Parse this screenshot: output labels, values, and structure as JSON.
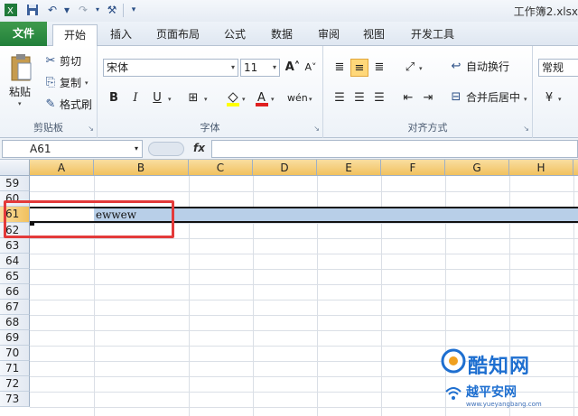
{
  "window": {
    "title": "工作簿2.xlsx"
  },
  "qat": {
    "icons": [
      "excel-app-icon",
      "save-icon",
      "undo-icon",
      "redo-icon",
      "format-painter-icon",
      "customize-qat-icon"
    ]
  },
  "tabs": [
    {
      "label": "文件"
    },
    {
      "label": "开始"
    },
    {
      "label": "插入"
    },
    {
      "label": "页面布局"
    },
    {
      "label": "公式"
    },
    {
      "label": "数据"
    },
    {
      "label": "审阅"
    },
    {
      "label": "视图"
    },
    {
      "label": "开发工具"
    }
  ],
  "ribbon": {
    "clipboard": {
      "label": "剪贴板",
      "paste": "粘贴",
      "cut": "剪切",
      "copy": "复制",
      "format_painter": "格式刷"
    },
    "font": {
      "label": "字体",
      "font_name": "宋体",
      "font_size": "11",
      "bold": "B",
      "italic": "I",
      "underline": "U"
    },
    "alignment": {
      "label": "对齐方式",
      "wrap_text": "自动换行",
      "merge_center": "合并后居中"
    },
    "number": {
      "format": "常规"
    }
  },
  "formula_bar": {
    "name_box": "A61",
    "fx": "fx",
    "content": ""
  },
  "grid": {
    "columns": [
      "A",
      "B",
      "C",
      "D",
      "E",
      "F",
      "G",
      "H"
    ],
    "selected_columns": [
      "A",
      "B",
      "C",
      "D",
      "E",
      "F",
      "G",
      "H"
    ],
    "rows": [
      "59",
      "60",
      "61",
      "62",
      "63",
      "64",
      "65",
      "66",
      "67",
      "68",
      "69",
      "70",
      "71",
      "72",
      "73"
    ],
    "selected_row": "61",
    "cells": {
      "B61": "ewwew"
    }
  },
  "watermark": {
    "title": "酷知网",
    "subtitle": "越平安网",
    "url": "www.yueyangbang.com"
  },
  "colors": {
    "file_tab": "#21803a",
    "highlight": "#e33a3a",
    "selection": "#b8cfe8",
    "header_selected": "#f1c15e"
  }
}
